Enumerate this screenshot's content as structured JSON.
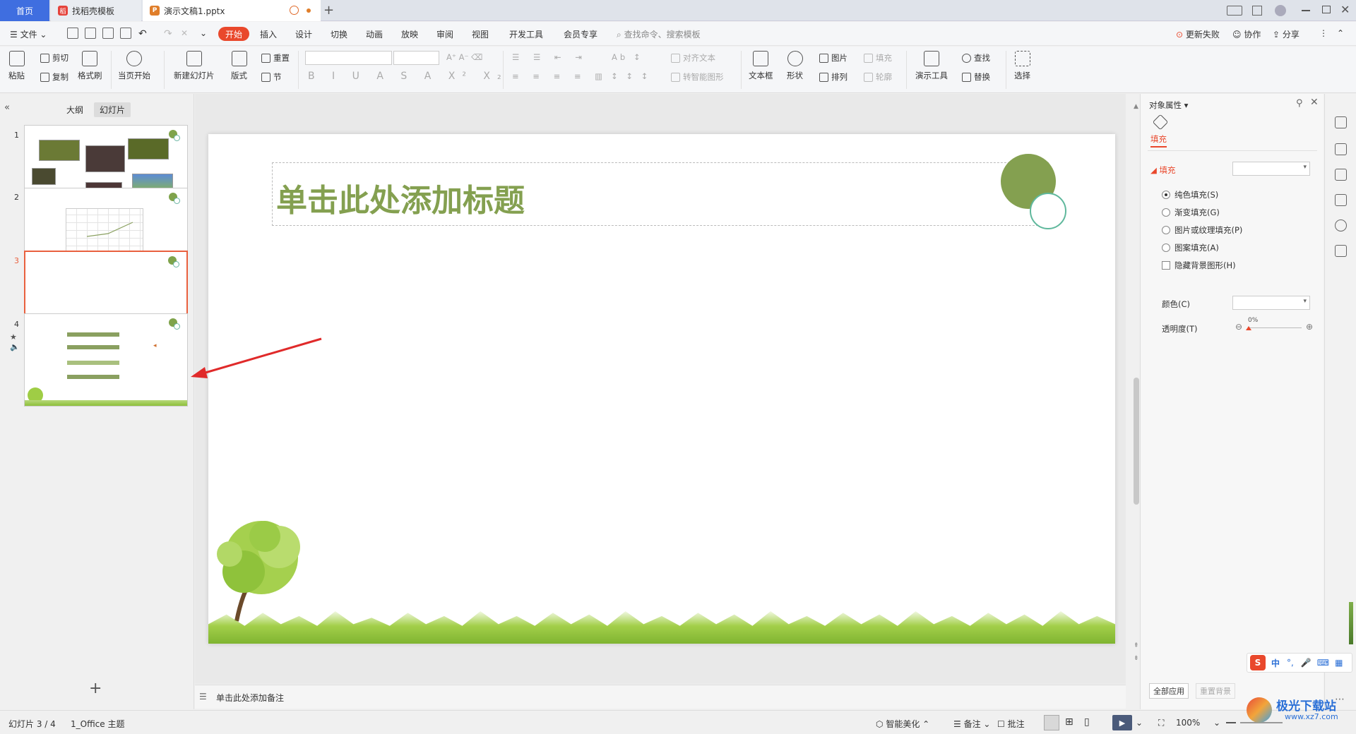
{
  "tabs": {
    "home": "首页",
    "template": "找稻壳模板",
    "document": "演示文稿1.pptx"
  },
  "menu": {
    "file": "文件",
    "start": "开始",
    "items": [
      "插入",
      "设计",
      "切换",
      "动画",
      "放映",
      "审阅",
      "视图",
      "开发工具",
      "会员专享"
    ],
    "search": "查找命令、搜索模板",
    "update_fail": "更新失败",
    "collab": "协作",
    "share": "分享"
  },
  "ribbon": {
    "paste": "粘贴",
    "cut": "剪切",
    "copy": "复制",
    "format_painter": "格式刷",
    "from_current": "当页开始",
    "new_slide": "新建幻灯片",
    "layout": "版式",
    "reset": "重置",
    "section": "节",
    "align_text": "对齐文本",
    "smart_shape": "转智能图形",
    "textbox": "文本框",
    "shape": "形状",
    "picture": "图片",
    "arrange": "排列",
    "fill": "填充",
    "outline": "轮廓",
    "present_tools": "演示工具",
    "find": "查找",
    "replace": "替换",
    "select": "选择"
  },
  "left": {
    "outline_tab": "大纲",
    "slides_tab": "幻灯片",
    "slide_nums": [
      "1",
      "2",
      "3",
      "4"
    ]
  },
  "slide": {
    "title_placeholder": "单击此处添加标题"
  },
  "notes": {
    "placeholder": "单击此处添加备注"
  },
  "panel": {
    "title": "对象属性",
    "fill_tab": "填充",
    "section": "填充",
    "opts": [
      "纯色填充(S)",
      "渐变填充(G)",
      "图片或纹理填充(P)",
      "图案填充(A)"
    ],
    "hide_bg": "隐藏背景图形(H)",
    "color_label": "颜色(C)",
    "transparency_label": "透明度(T)",
    "transparency_value": "0%",
    "apply_all": "全部应用",
    "reset_bg": "重置背景"
  },
  "status": {
    "slide_count": "幻灯片 3 / 4",
    "theme": "1_Office 主题",
    "smart_beautify": "智能美化",
    "notes": "备注",
    "comments": "批注",
    "zoom": "100%"
  },
  "ime": {
    "lang": "中"
  },
  "watermark": {
    "text": "极光下载站",
    "url": "www.xz7.com"
  },
  "colors": {
    "accent": "#e9482c",
    "title": "#84a050",
    "selected_border": "#e9603e"
  }
}
